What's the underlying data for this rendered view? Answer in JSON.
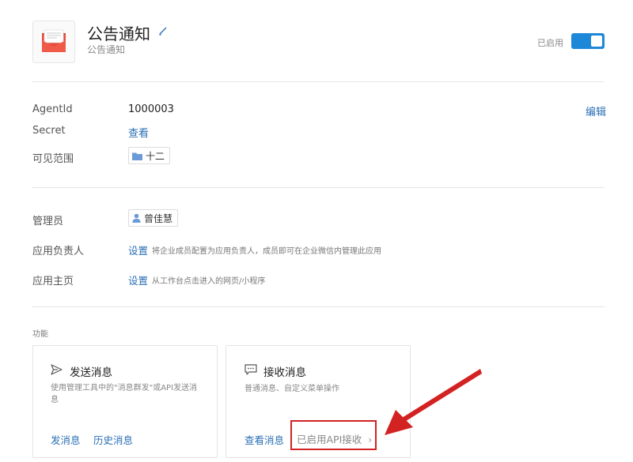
{
  "header": {
    "app_icon": "envelope-icon",
    "title": "公告通知",
    "subtitle": "公告通知",
    "status_label": "已启用",
    "toggle_on": true,
    "accent_color": "#1e88d8"
  },
  "info": {
    "agentid_label": "AgentId",
    "agentid_value": "1000003",
    "edit_label": "编辑",
    "secret_label": "Secret",
    "secret_link": "查看",
    "visibility_label": "可见范围",
    "visibility_tag": "十二"
  },
  "admin": {
    "admin_label": "管理员",
    "admin_name": "曾佳慧",
    "owner_label": "应用负责人",
    "owner_link": "设置",
    "owner_hint": "将企业成员配置为应用负责人，成员即可在企业微信内管理此应用",
    "homepage_label": "应用主页",
    "homepage_link": "设置",
    "homepage_hint": "从工作台点击进入的网页/小程序"
  },
  "features": {
    "section_label": "功能",
    "send_card": {
      "title": "发送消息",
      "desc": "使用管理工具中的\"消息群发\"或API发送消息",
      "link1": "发消息",
      "link2": "历史消息"
    },
    "receive_card": {
      "title": "接收消息",
      "desc": "普通消息、自定义菜单操作",
      "link1": "查看消息",
      "status": "已启用API接收",
      "annotation_color": "#d32222"
    }
  }
}
